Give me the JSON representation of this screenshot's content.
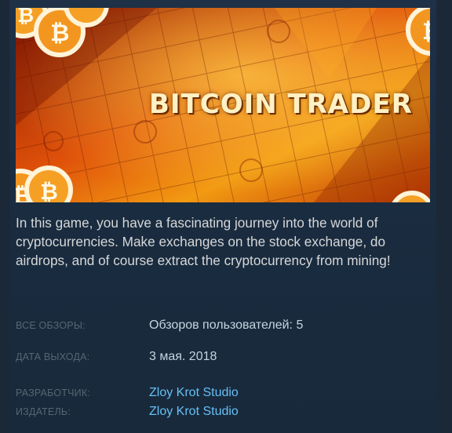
{
  "header": {
    "title": "BITCOIN TRADER",
    "image_icon": "bitcoin-coin-icon"
  },
  "description": "In this game, you have a fascinating journey into the world of cryptocurrencies. Make exchanges on the stock exchange, do airdrops, and of course extract the cryptocurrency from mining!",
  "meta": {
    "reviews": {
      "label": "ВСЕ ОБЗОРЫ:",
      "value": "Обзоров пользователей: 5"
    },
    "release": {
      "label": "ДАТА ВЫХОДА:",
      "value": "3 мая. 2018"
    },
    "developer": {
      "label": "РАЗРАБОТЧИК:",
      "value": "Zloy Krot Studio"
    },
    "publisher": {
      "label": "ИЗДАТЕЛЬ:",
      "value": "Zloy Krot Studio"
    }
  },
  "colors": {
    "background": "#1b2838",
    "link": "#66c0f4",
    "label": "#556772",
    "text": "#d6d7d8"
  }
}
